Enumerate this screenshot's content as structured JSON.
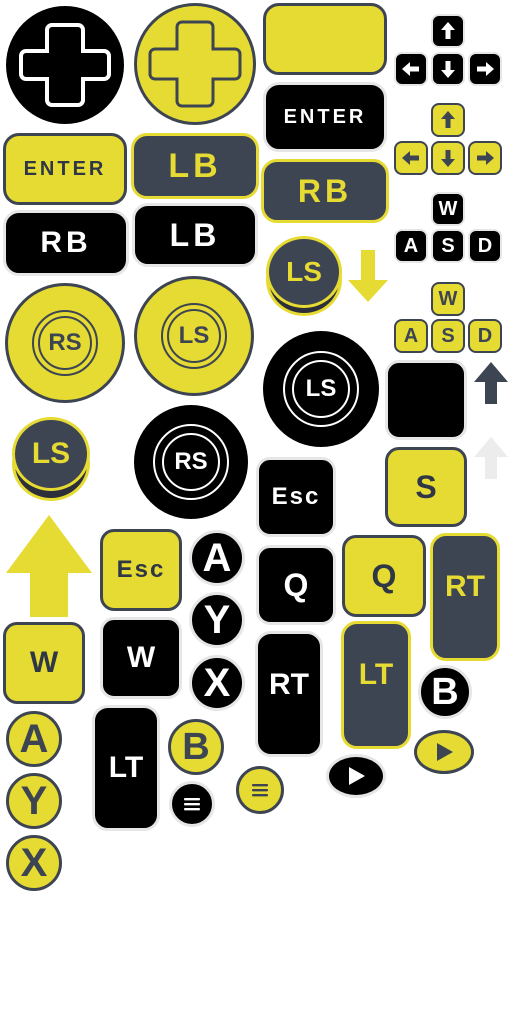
{
  "palette": {
    "yellow": "#e6db32",
    "black": "#000000",
    "slate": "#3e4552",
    "light": "#e6e6e6"
  },
  "icons": {
    "dpad": "dpad-cross-icon",
    "arrows": "arrow-icon",
    "menu": "menu-lines-icon",
    "start": "play-triangle-icon"
  },
  "labels": {
    "enter": "ENTER",
    "lb": "LB",
    "rb": "RB",
    "ls": "LS",
    "rs": "RS",
    "esc": "Esc",
    "q": "Q",
    "rt": "RT",
    "lt": "LT",
    "w": "W",
    "a": "A",
    "s": "S",
    "d": "D",
    "btn_a": "A",
    "btn_b": "B",
    "btn_x": "X",
    "btn_y": "Y"
  }
}
